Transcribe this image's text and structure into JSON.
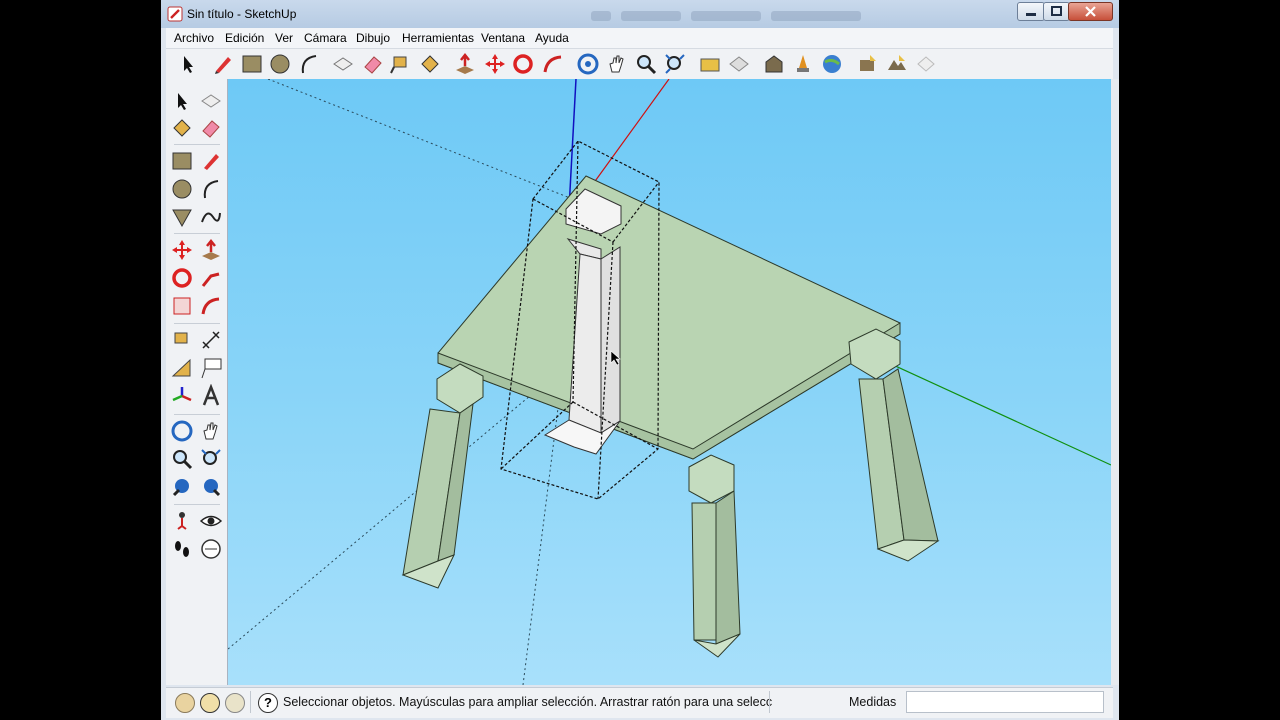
{
  "window": {
    "title": "Sin título - SketchUp"
  },
  "menu": {
    "items": [
      "Archivo",
      "Edición",
      "Ver",
      "Cámara",
      "Dibujo",
      "Herramientas",
      "Ventana",
      "Ayuda"
    ]
  },
  "toolbar": {
    "tools": [
      "select-tool",
      "pencil-tool",
      "rectangle-tool",
      "circle-tool",
      "arc-tool",
      "make-component-tool",
      "eraser-tool",
      "tape-measure-tool",
      "paint-bucket-tool",
      "push-pull-tool",
      "move-tool",
      "rotate-tool",
      "follow-me-tool",
      "orbit-tool",
      "pan-tool",
      "zoom-tool",
      "zoom-extents-tool",
      "get-models-tool",
      "share-model-tool",
      "share-component-tool",
      "photo-textures-tool",
      "google-earth-tool",
      "preview-in-earth-tool",
      "get-current-view-tool",
      "toggle-terrain-tool"
    ]
  },
  "statusbar": {
    "message": "Seleccionar objetos. Mayúsculas para ampliar selección. Arrastrar ratón para una selecc",
    "measurements_label": "Medidas",
    "measurements_value": ""
  },
  "colors": {
    "sky": "#7fcff7",
    "model_face": "#b9d4b2",
    "model_edge": "#2d3a2a",
    "red_axis": "#d01010",
    "green_axis": "#109010",
    "blue_axis": "#1010c0"
  }
}
